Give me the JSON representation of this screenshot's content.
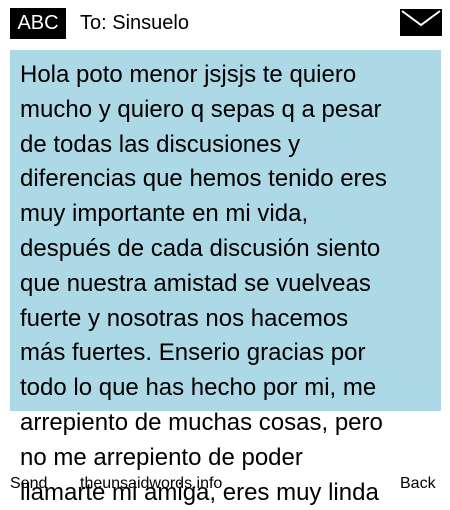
{
  "header": {
    "badge": "ABC",
    "to": "To: Sinsuelo",
    "envelope_icon": "envelope-icon"
  },
  "message": {
    "text": "Hola poto menor jsjsjs te quiero\nmucho y quiero q sepas q a pesar\nde todas las discusiones y\ndiferencias que hemos tenido eres\nmuy importante en mi vida,\ndespués de cada discusión siento\nque nuestra amistad se vuelveas\nfuerte y nosotras nos hacemos\nmás fuertes. Enserio gracias por\ntodo lo que has hecho por mi, me\narrepiento de muchas cosas, pero\nno me arrepiento de poder\nllamarte mi amiga, eres muy linda"
  },
  "footer": {
    "send": "Send",
    "site": "theunsaidwords.info",
    "back": "Back"
  },
  "colors": {
    "bubble": "#add8e6",
    "badge": "#000000"
  }
}
